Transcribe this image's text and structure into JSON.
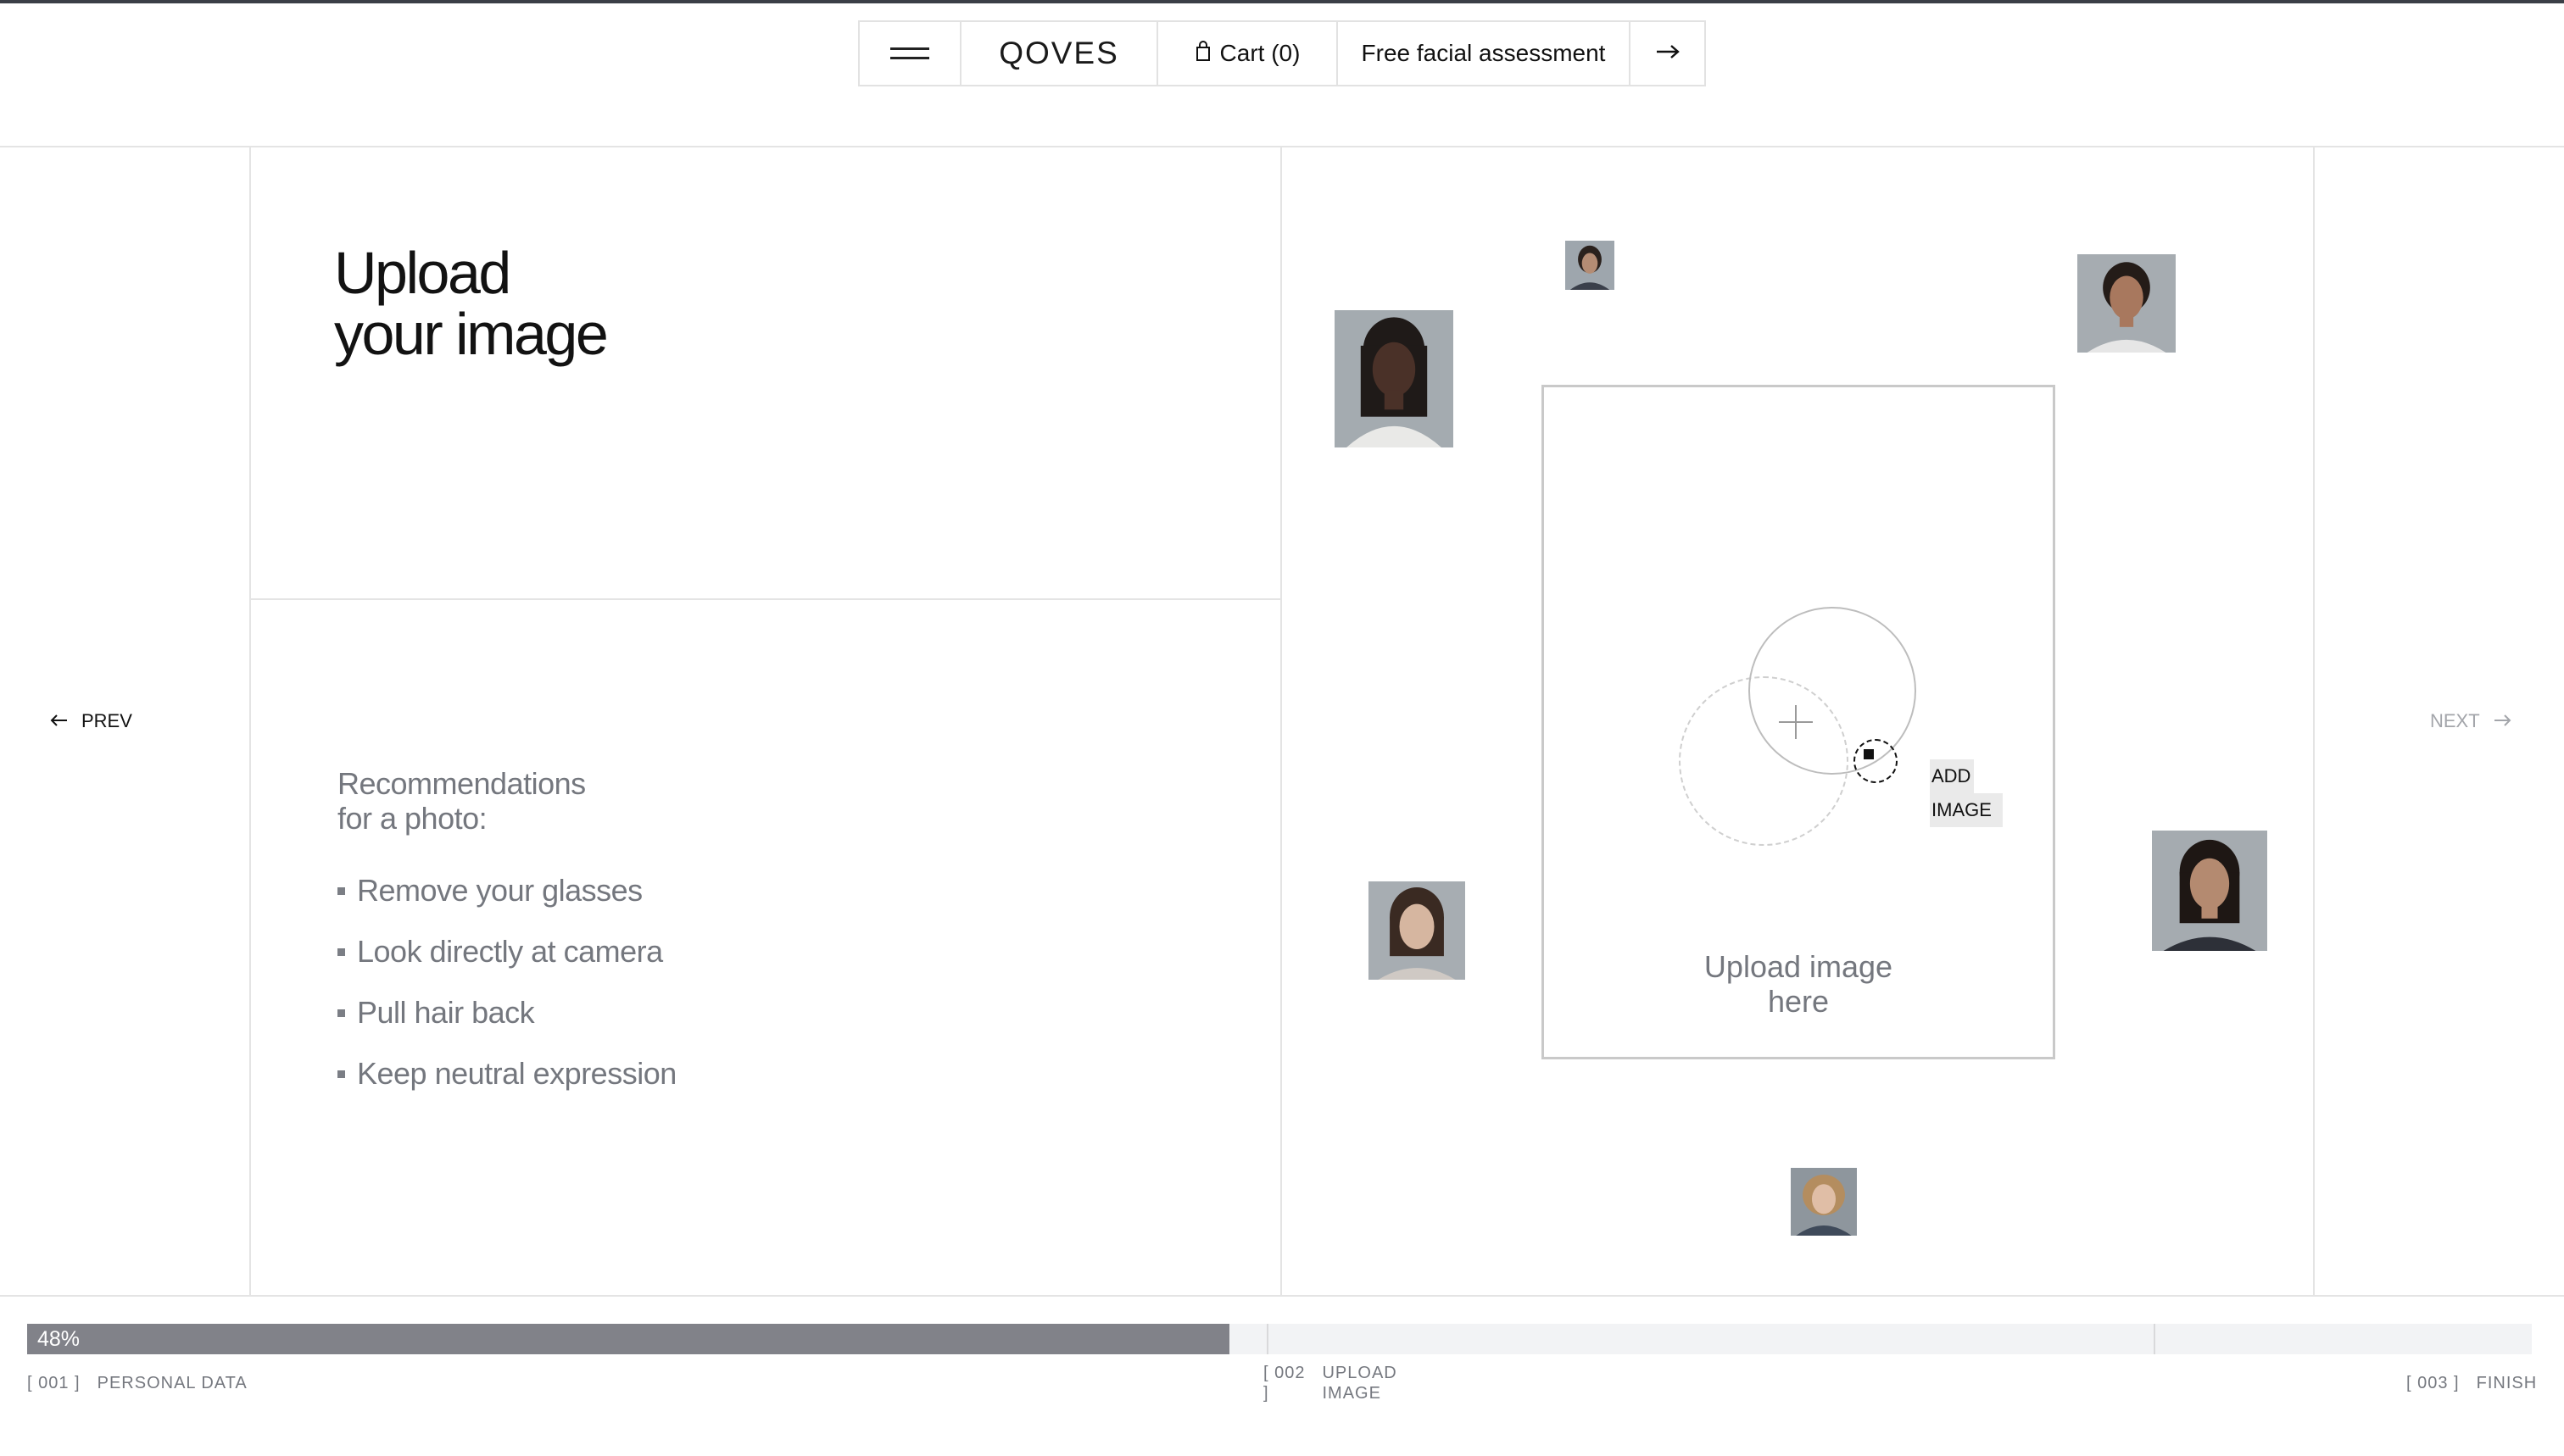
{
  "header": {
    "logo": "QOVES",
    "cart_label": "Cart (0)",
    "assessment_label": "Free facial assessment"
  },
  "main": {
    "title_line1": "Upload",
    "title_line2": "your image",
    "recommendations_line1": "Recommendations",
    "recommendations_line2": "for a photo:",
    "recommendations": [
      "Remove your glasses",
      "Look directly at camera",
      "Pull hair back",
      "Keep neutral expression"
    ]
  },
  "nav": {
    "prev_label": "PREV",
    "next_label": "NEXT"
  },
  "upload": {
    "prompt_line1": "Upload image",
    "prompt_line2": "here",
    "add_line1": "ADD",
    "add_line2": "IMAGE"
  },
  "progress": {
    "percent_label": "48%",
    "percent": 48,
    "steps": [
      {
        "number": "[ 001 ]",
        "label": "PERSONAL DATA"
      },
      {
        "number_line1": "[ 002",
        "number_line2": "]",
        "label_line1": "UPLOAD",
        "label_line2": "IMAGE"
      },
      {
        "number": "[ 003 ]",
        "label": "FINISH"
      }
    ]
  },
  "icons": {
    "menu": "hamburger-menu-icon",
    "cart": "shopping-bag-icon",
    "go": "arrow-right-icon",
    "prev": "arrow-left-icon",
    "next": "arrow-right-icon",
    "upload": "plus-icon"
  },
  "colors": {
    "progress_fill": "#818289",
    "progress_track": "#f2f3f5",
    "muted_text": "#74777e"
  }
}
